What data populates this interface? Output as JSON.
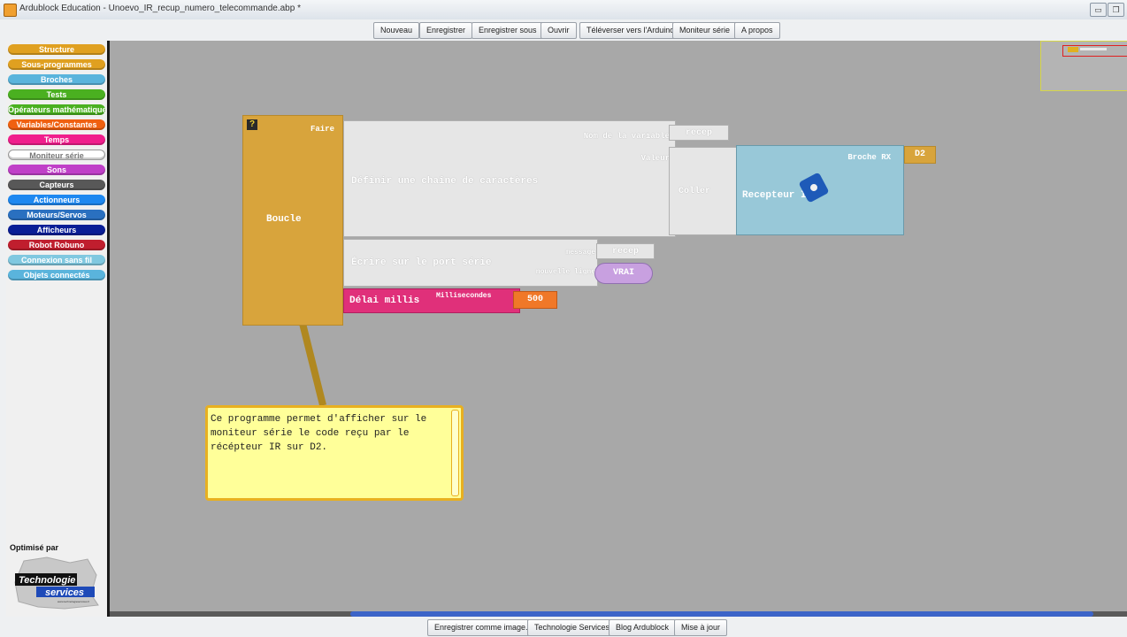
{
  "window": {
    "title": "Ardublock Education - Unoevo_IR_recup_numero_telecommande.abp *"
  },
  "toolbar": {
    "buttons": [
      "Nouveau",
      "Enregistrer",
      "Enregistrer sous",
      "Ouvrir",
      "Téléverser vers l'Arduino",
      "Moniteur série",
      "A propos"
    ]
  },
  "palette": {
    "categories": [
      {
        "label": "Structure",
        "color": "#e0a020"
      },
      {
        "label": "Sous-programmes",
        "color": "#e0a020"
      },
      {
        "label": "Broches",
        "color": "#5ab4dc"
      },
      {
        "label": "Tests",
        "color": "#4ab020"
      },
      {
        "label": "Opérateurs mathématiques",
        "color": "#4ab020"
      },
      {
        "label": "Variables/Constantes",
        "color": "#f06010"
      },
      {
        "label": "Temps",
        "color": "#f01e8c"
      },
      {
        "label": "Moniteur série",
        "color": "#ffffff"
      },
      {
        "label": "Sons",
        "color": "#c040c8"
      },
      {
        "label": "Capteurs",
        "color": "#585858"
      },
      {
        "label": "Actionneurs",
        "color": "#1e88f0"
      },
      {
        "label": "Moteurs/Servos",
        "color": "#2a70c0"
      },
      {
        "label": "Afficheurs",
        "color": "#0a1e96"
      },
      {
        "label": "Robot Robuno",
        "color": "#c01e2e"
      },
      {
        "label": "Connexion sans fil",
        "color": "#80c8e0"
      },
      {
        "label": "Objets connectés",
        "color": "#5ab4dc"
      }
    ],
    "optimise_label": "Optimisé par",
    "logo": {
      "line1": "Technologie",
      "line2": "services",
      "url": "www.technologieservices.fr"
    }
  },
  "blocks": {
    "help_icon": "?",
    "boucle": {
      "label": "Boucle",
      "faire": "Faire"
    },
    "define_string": {
      "label": "Définir une chaîne de caractères",
      "nom_label": "Nom de la variable",
      "nom_value": "recep",
      "valeur_label": "Valeur"
    },
    "coller": {
      "label": "Coller"
    },
    "recepteur": {
      "label": "Recepteur IR",
      "broche_label": "Broche RX",
      "broche_value": "D2"
    },
    "ecrire": {
      "label": "Écrire sur le port série",
      "message_label": "message",
      "message_value": "recep",
      "nouvelle_label": "nouvelle ligne",
      "nouvelle_value": "VRAI"
    },
    "delai": {
      "label": "Délai millis",
      "ms_label": "Millisecondes",
      "ms_value": "500"
    }
  },
  "comment": {
    "text": "Ce programme permet d'afficher sur le moniteur série le code reçu par le récépteur IR sur D2."
  },
  "bottombar": {
    "buttons": [
      "Enregistrer comme image...",
      "Technologie Services",
      "Blog Ardublock",
      "Mise à jour"
    ]
  }
}
